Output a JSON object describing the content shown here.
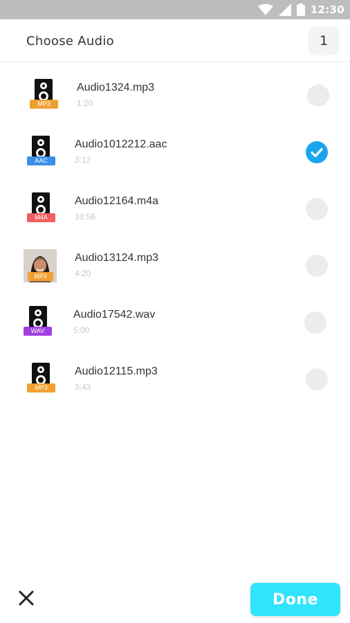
{
  "status_bar": {
    "time": "12:30",
    "icons": [
      "wifi-icon",
      "signal-icon",
      "battery-icon"
    ]
  },
  "header": {
    "title": "Choose Audio",
    "selected_count": "1"
  },
  "items": [
    {
      "name": "Audio1324.mp3",
      "duration": "1:20",
      "format": "MP3",
      "badge_color": "#f0a030",
      "thumbnail": "speaker-icon",
      "checked": false
    },
    {
      "name": "Audio1012212.aac",
      "duration": "3:12",
      "format": "AAC",
      "badge_color": "#3a8fe8",
      "thumbnail": "speaker-icon",
      "checked": true
    },
    {
      "name": "Audio12164.m4a",
      "duration": "10:56",
      "format": "M4A",
      "badge_color": "#f06060",
      "thumbnail": "speaker-icon",
      "checked": false
    },
    {
      "name": "Audio13124.mp3",
      "duration": "4:20",
      "format": "MP3",
      "badge_color": "#f0a030",
      "thumbnail": "portrait-photo",
      "checked": false
    },
    {
      "name": "Audio17542.wav",
      "duration": "5:00",
      "format": "WAV",
      "badge_color": "#a040e0",
      "thumbnail": "speaker-icon",
      "checked": false
    },
    {
      "name": "Audio12115.mp3",
      "duration": "3:43",
      "format": "MP3",
      "badge_color": "#f0a030",
      "thumbnail": "speaker-icon",
      "checked": false
    }
  ],
  "footer": {
    "close_icon": "close-icon",
    "done_label": "Done"
  },
  "colors": {
    "accent": "#2fe4fb",
    "check": "#1aa6ef",
    "status_bar": "#bdbdbd"
  }
}
